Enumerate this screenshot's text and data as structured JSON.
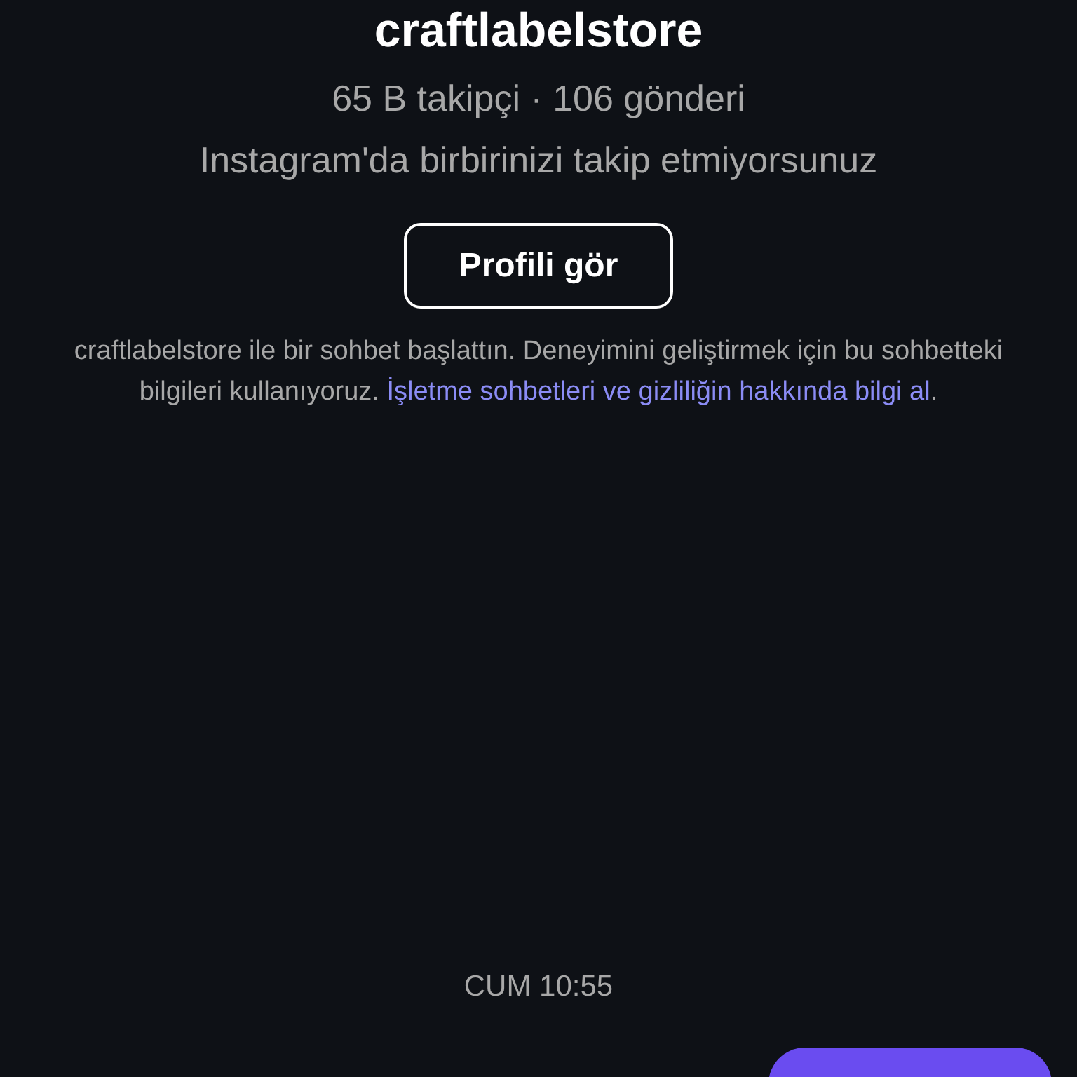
{
  "profile": {
    "username": "craftlabelstore",
    "stats": "65 B takipçi · 106 gönderi",
    "relation": "Instagram'da birbirinizi takip etmiyorsunuz",
    "button": "Profili gör"
  },
  "notice": {
    "text": "craftlabelstore ile bir sohbet başlattın. Deneyimini geliştirmek için bu sohbetteki bilgileri kullanıyoruz.",
    "link": "İşletme sohbetleri ve gizliliğin hakkında bilgi al",
    "end": "."
  },
  "timestamp": "CUM 10:55",
  "messages": [
    {
      "kind": "outgoing"
    }
  ]
}
